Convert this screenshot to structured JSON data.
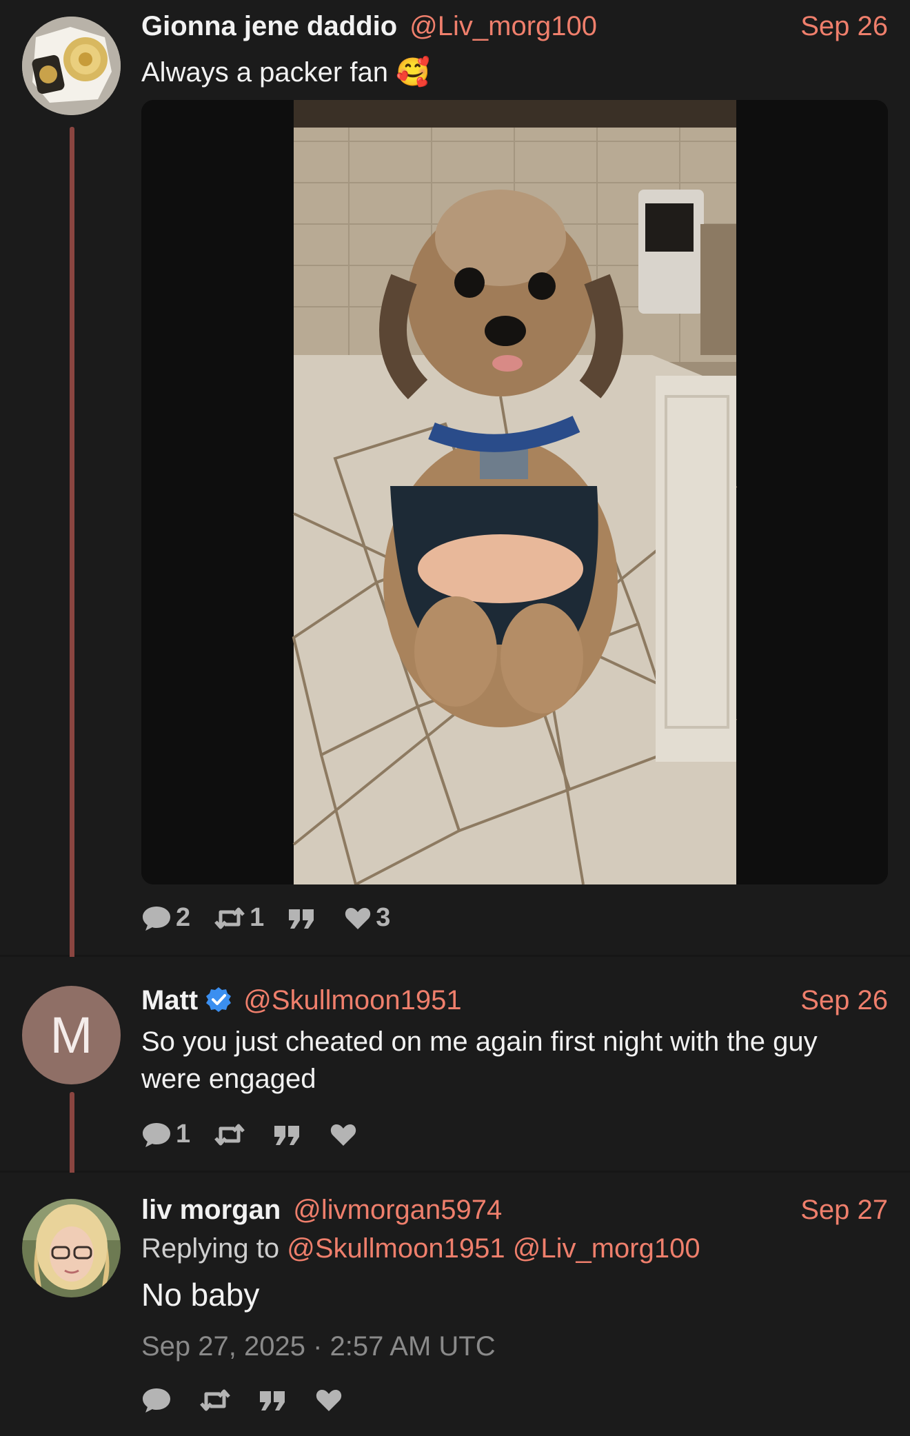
{
  "tweets": [
    {
      "name": "Gionna jene daddio",
      "handle": "@Liv_morg100",
      "date": "Sep 26",
      "text": "Always a packer fan 🥰",
      "avatar_icon": "championship-belt-avatar",
      "media": {
        "kind": "photo",
        "subject": "dog-in-packers-jersey"
      },
      "stats": {
        "replies": "2",
        "retweets": "1",
        "quotes": "",
        "likes": "3"
      }
    },
    {
      "name": "Matt",
      "handle": "@Skullmoon1951",
      "date": "Sep 26",
      "avatar_letter": "M",
      "verified": true,
      "text": "So you just cheated on me again first night with the guy were engaged",
      "stats": {
        "replies": "1",
        "retweets": "",
        "quotes": "",
        "likes": ""
      }
    },
    {
      "name": "liv morgan",
      "handle": "@livmorgan5974",
      "date": "Sep 27",
      "replying_label": "Replying to",
      "replying_to": [
        "@Skullmoon1951",
        "@Liv_morg100"
      ],
      "text": "No baby",
      "full_date": "Sep 27, 2025 · 2:57 AM UTC",
      "avatar_icon": "blonde-woman-avatar",
      "stats": {
        "replies": "",
        "retweets": "",
        "quotes": "",
        "likes": ""
      }
    }
  ],
  "colors": {
    "background": "#1b1b1b",
    "accent": "#ef7f6c",
    "thread_line": "#8a4540",
    "verified": "#3b8ff0"
  },
  "icons": {
    "reply": "comment-bubble-icon",
    "retweet": "retweet-icon",
    "quote": "quote-icon",
    "like": "heart-icon"
  }
}
